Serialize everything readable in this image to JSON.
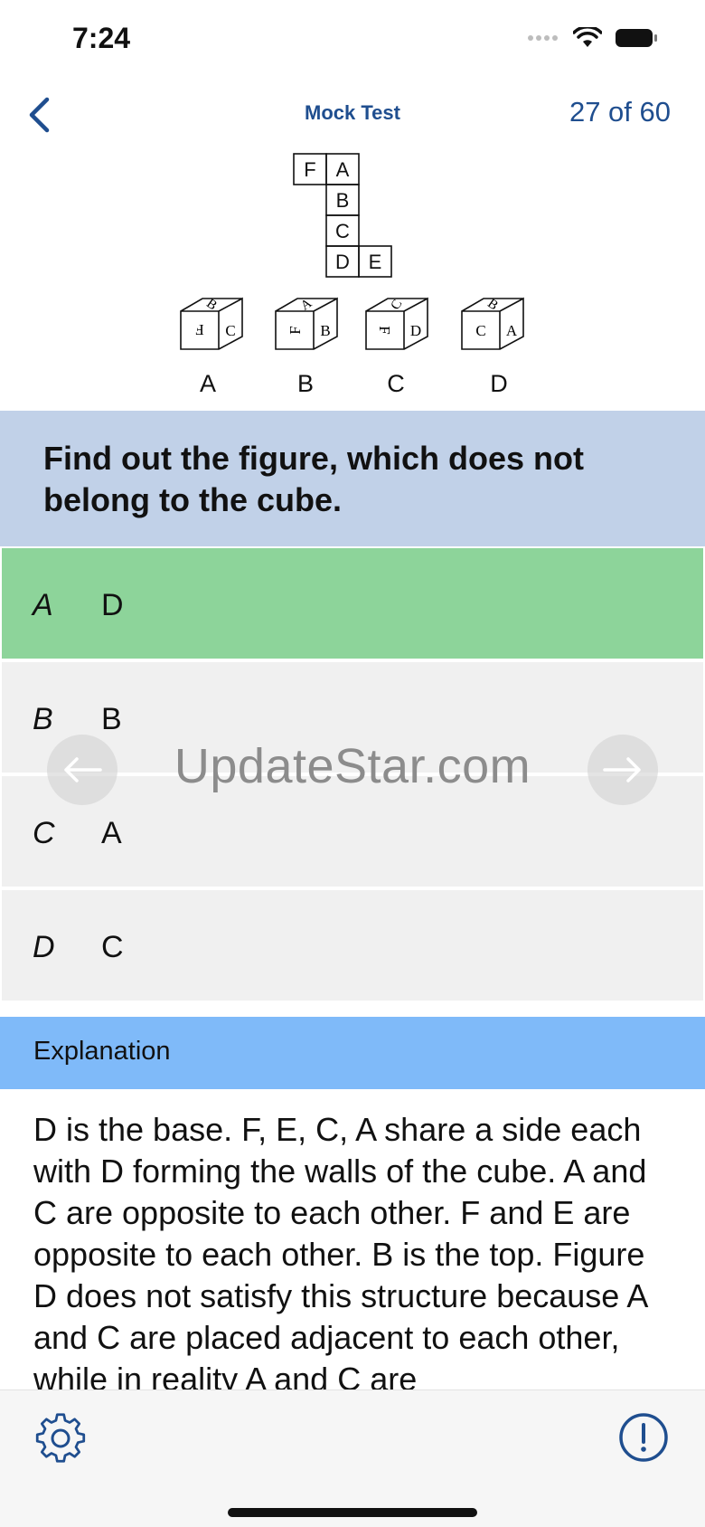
{
  "status": {
    "time": "7:24"
  },
  "nav": {
    "title": "Mock Test",
    "counter": "27 of 60"
  },
  "figure": {
    "net_letters": [
      "F",
      "A",
      "B",
      "C",
      "D",
      "E"
    ],
    "cube_faces": [
      {
        "top": "B",
        "left": "F",
        "right": "C"
      },
      {
        "top": "A",
        "left": "F",
        "right": "B"
      },
      {
        "top": "C",
        "left": "F",
        "right": "D"
      },
      {
        "top": "B",
        "left": "C",
        "right": "A"
      }
    ],
    "cube_labels": [
      "A",
      "B",
      "C",
      "D"
    ]
  },
  "question": {
    "text": "Find out the figure, which does not belong to the cube."
  },
  "options": [
    {
      "letter": "A",
      "value": "D",
      "state": "correct"
    },
    {
      "letter": "B",
      "value": "B",
      "state": "default"
    },
    {
      "letter": "C",
      "value": "A",
      "state": "default"
    },
    {
      "letter": "D",
      "value": "C",
      "state": "default"
    }
  ],
  "watermark": "UpdateStar.com",
  "explanation": {
    "header": "Explanation",
    "body": "D is the base. F, E, C, A share a side each with D forming the walls of the cube. A and C are opposite to each other. F and E are opposite to each other. B is the top. Figure D does not satisfy this structure because A and C are placed adjacent to each other, while in reality A and C are"
  },
  "icons": {
    "back": "chevron-left-icon",
    "prev": "arrow-left-icon",
    "next": "arrow-right-icon",
    "settings": "gear-icon",
    "info": "exclamation-circle-icon"
  },
  "colors": {
    "accent": "#1f4e8f",
    "question_bg": "#c1d1e8",
    "correct_bg": "#8dd49a",
    "option_bg": "#f0f0f0",
    "explanation_bg": "#7fbaf9"
  }
}
